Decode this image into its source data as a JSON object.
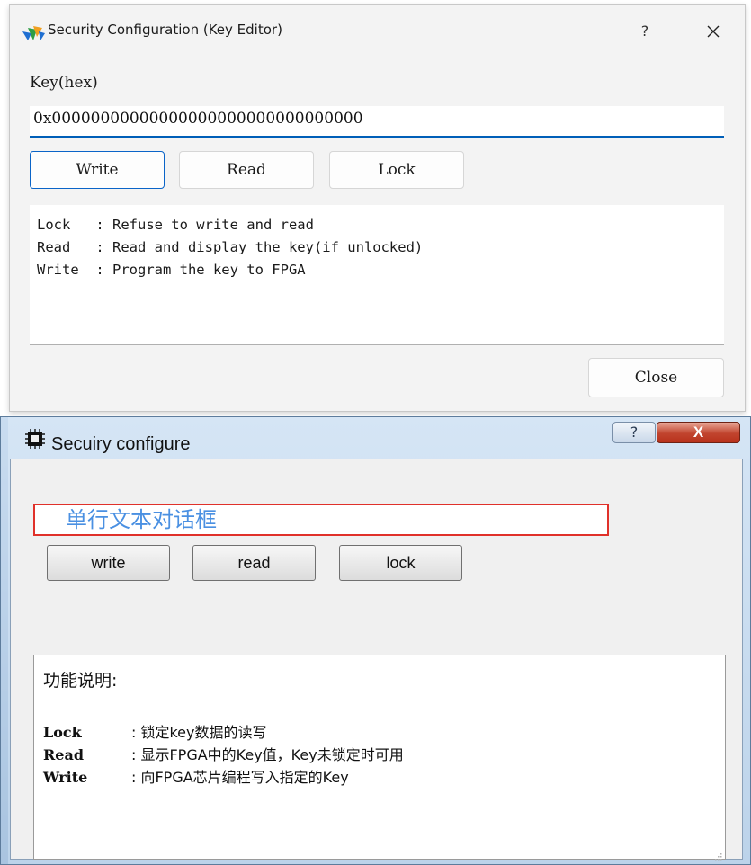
{
  "top_dialog": {
    "title": "Security Configuration (Key Editor)",
    "help_glyph": "?",
    "key_label": "Key(hex)",
    "key_value": "0x00000000000000000000000000000000",
    "buttons": {
      "write": "Write",
      "read": "Read",
      "lock": "Lock"
    },
    "help_lines": [
      "Lock   : Refuse to write and read",
      "Read   : Read and display the key(if unlocked)",
      "Write  : Program the key to FPGA"
    ],
    "close_label": "Close",
    "accent": "#005fb8"
  },
  "bottom_dialog": {
    "title": "Secuiry configure",
    "help_glyph": "?",
    "close_glyph": "X",
    "line_input_text": "单行文本对话框",
    "buttons": {
      "write": "write",
      "read": "read",
      "lock": "lock"
    },
    "desc_title": "功能说明:",
    "desc_rows": [
      {
        "key": "Lock",
        "value": ": 锁定key数据的读写"
      },
      {
        "key": "Read",
        "value": ": 显示FPGA中的Key值，Key未锁定时可用"
      },
      {
        "key": "Write",
        "value": ": 向FPGA芯片编程写入指定的Key"
      }
    ],
    "input_border_color": "#e0312a",
    "input_text_color": "#4a90e2"
  },
  "icons": [
    "app-logo-icon",
    "close-icon",
    "chip-icon",
    "resize-grip-icon"
  ]
}
